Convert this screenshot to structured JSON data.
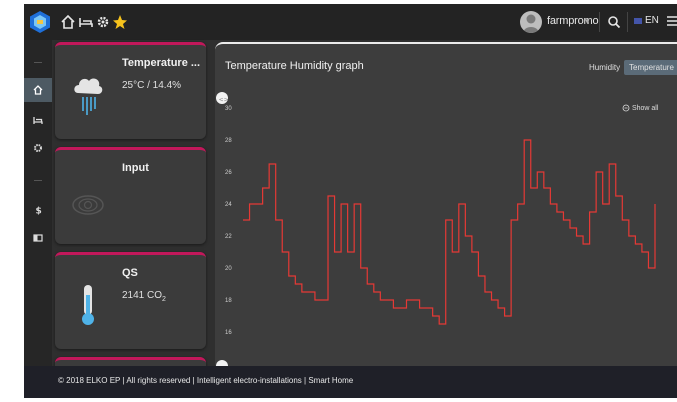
{
  "topbar": {
    "username": "farmpromo",
    "language": "EN",
    "icons": [
      "home-icon",
      "bed-icon",
      "gear-icon",
      "star-icon",
      "search-icon",
      "menu-icon"
    ]
  },
  "sidebar": {
    "items": [
      "home-icon",
      "bed-icon",
      "gear-icon",
      "dollar-icon",
      "panel-icon"
    ],
    "active": "home-icon"
  },
  "cards": [
    {
      "title": "Temperature ...",
      "value": "25°C / 14.4%",
      "icon": "humidity-cloud-icon"
    },
    {
      "title": "Input",
      "value": "",
      "icon": "eye-icon"
    },
    {
      "title": "QS",
      "value": "2141 CO",
      "value_sub": "2",
      "icon": "thermometer-icon"
    }
  ],
  "graph": {
    "title": "Temperature Humidity graph",
    "tabs": [
      "Humidity",
      "Temperature"
    ],
    "active_tab": "Temperature",
    "show_all": "Show all",
    "line_color": "#e53935",
    "accent_color": "#c2185b"
  },
  "chart_data": {
    "type": "line",
    "yticks": [
      16,
      18,
      20,
      22,
      24,
      26,
      28,
      30
    ],
    "ylim": [
      14,
      31
    ],
    "grid": false,
    "series": [
      {
        "values": [
          23,
          24,
          24,
          25,
          26.5,
          23,
          21,
          19.5,
          19,
          18.5,
          18.5,
          18,
          18,
          24.5,
          21,
          24,
          21,
          24,
          20,
          19,
          18.5,
          18,
          18,
          17.5,
          17.5,
          18,
          18,
          17.5,
          17.5,
          17,
          16.5,
          23,
          21,
          24,
          22,
          21,
          19.5,
          18.5,
          18,
          17.5,
          17,
          23,
          24,
          28,
          25,
          26,
          25,
          24,
          23.5,
          23,
          22.5,
          22,
          21.5,
          23.5,
          26,
          24,
          26.5,
          24.5,
          23,
          22,
          21.5,
          21,
          20,
          24
        ]
      }
    ]
  },
  "footer": {
    "text": "© 2018 ELKO EP | All rights reserved | Intelligent electro-installations | Smart Home"
  }
}
